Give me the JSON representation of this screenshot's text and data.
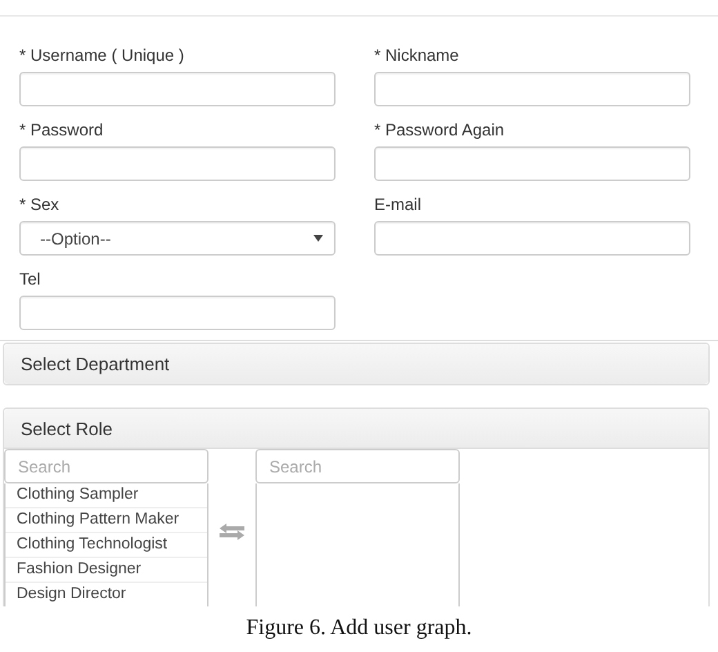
{
  "form": {
    "fields": [
      {
        "label": "* Username ( Unique )",
        "kind": "text"
      },
      {
        "label": "* Nickname",
        "kind": "text"
      },
      {
        "label": "* Password",
        "kind": "text"
      },
      {
        "label": "* Password Again",
        "kind": "text"
      },
      {
        "label": "* Sex",
        "kind": "select",
        "value": "--Option--"
      },
      {
        "label": "E-mail",
        "kind": "text"
      },
      {
        "label": "Tel",
        "kind": "text"
      }
    ]
  },
  "department_panel": {
    "title": "Select Department"
  },
  "role_panel": {
    "title": "Select Role",
    "available": {
      "search_placeholder": "Search",
      "items": [
        "Clothing Sampler",
        "Clothing Pattern Maker",
        "Clothing Technologist",
        "Fashion Designer",
        "Design Director"
      ]
    },
    "chosen": {
      "search_placeholder": "Search"
    }
  },
  "caption": "Figure 6. Add user graph."
}
